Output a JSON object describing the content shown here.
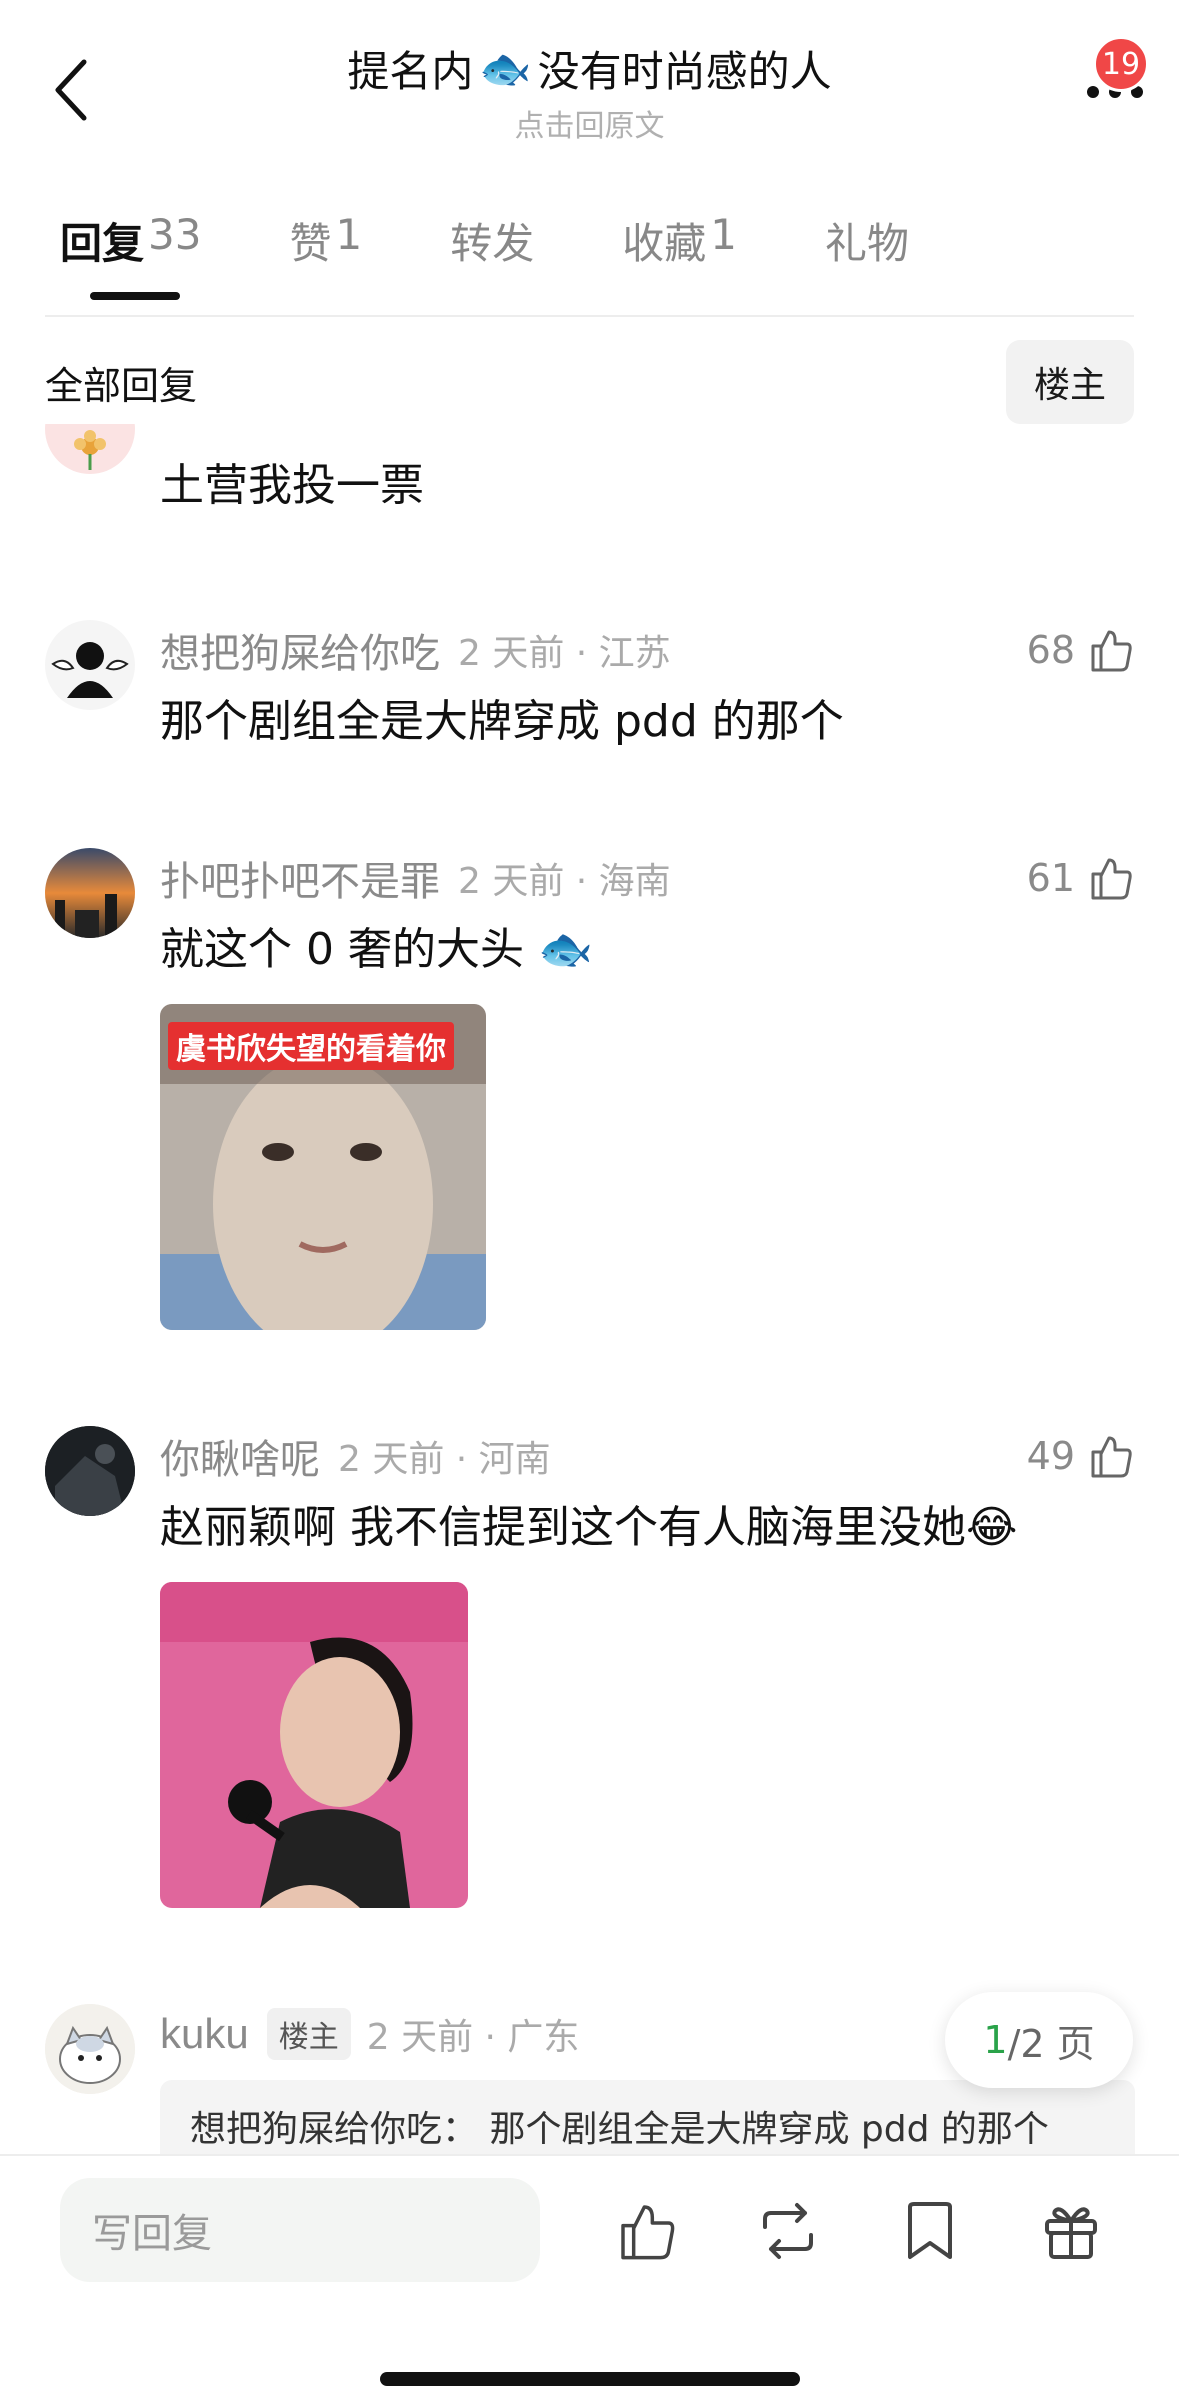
{
  "header": {
    "title_prefix": "提名内",
    "title_emoji": "🐟",
    "title_suffix": "没有时尚感的人",
    "subtitle": "点击回原文",
    "badge_count": "19"
  },
  "tabs": [
    {
      "label": "回复",
      "count": "33"
    },
    {
      "label": "赞",
      "count": "1"
    },
    {
      "label": "转发",
      "count": ""
    },
    {
      "label": "收藏",
      "count": "1"
    },
    {
      "label": "礼物",
      "count": ""
    }
  ],
  "filter": {
    "label": "全部回复",
    "op_button": "楼主"
  },
  "comments": [
    {
      "name": "",
      "time": "",
      "likes": "",
      "text": "土营我投一票"
    },
    {
      "name": "想把狗屎给你吃",
      "time": "2 天前 · 江苏",
      "likes": "68",
      "text": "那个剧组全是大牌穿成 pdd 的那个"
    },
    {
      "name": "扑吧扑吧不是罪",
      "time": "2 天前 · 海南",
      "likes": "61",
      "text": "就这个 0 奢的大头",
      "text_emoji": "🐟",
      "image_caption": "虞书欣失望的看着你"
    },
    {
      "name": "你瞅啥呢",
      "time": "2 天前 · 河南",
      "likes": "49",
      "text": "赵丽颖啊 我不信提到这个有人脑海里没她",
      "text_emoji": "😂"
    },
    {
      "name": "kuku",
      "op_tag": "楼主",
      "time": "2 天前 · 广东",
      "quote": "想把狗屎给你吃： 那个剧组全是大牌穿成 pdd 的那个"
    }
  ],
  "pager": {
    "current": "1",
    "total": "/2 页"
  },
  "bottom_bar": {
    "placeholder": "写回复"
  },
  "icons": {
    "back": "chevron-left-icon",
    "more": "more-dots-icon",
    "like": "thumb-up-icon",
    "repost": "repost-icon",
    "bookmark": "bookmark-icon",
    "gift": "gift-icon"
  },
  "colors": {
    "badge": "#f04747",
    "pager_current": "#2aa34a"
  }
}
